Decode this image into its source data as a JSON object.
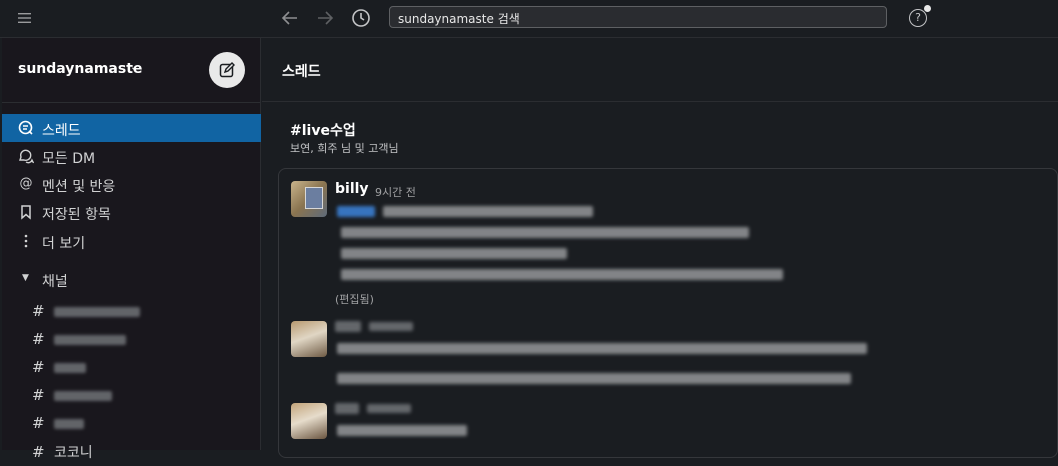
{
  "topbar": {
    "menu_icon": "hamburger-icon",
    "back_icon": "arrow-left-icon",
    "forward_icon": "arrow-right-icon",
    "history_icon": "clock-icon",
    "search_text": "sundaynamaste 검색",
    "help_icon": "help-icon"
  },
  "sidebar": {
    "workspace": "sundaynamaste",
    "compose_icon": "compose-icon",
    "items": [
      {
        "label": "스레드",
        "icon": "threads-icon",
        "active": true
      },
      {
        "label": "모든 DM",
        "icon": "dm-icon",
        "active": false
      },
      {
        "label": "멘션 및 반응",
        "icon": "at-icon",
        "active": false
      },
      {
        "label": "저장된 항목",
        "icon": "bookmark-icon",
        "active": false
      },
      {
        "label": "더 보기",
        "icon": "more-vertical-icon",
        "active": false
      }
    ],
    "channels_label": "채널",
    "channels_partial": "코코니"
  },
  "main": {
    "title": "스레드",
    "thread_channel": "#live수업",
    "thread_participants": "보연, 희주 님 및 고객님",
    "messages": [
      {
        "author": "billy",
        "time": "9시간 전",
        "edited": "(편집됨)"
      }
    ]
  },
  "colors": {
    "accent": "#1164a3",
    "background": "#1a1d21",
    "sidebar": "#19171d"
  }
}
